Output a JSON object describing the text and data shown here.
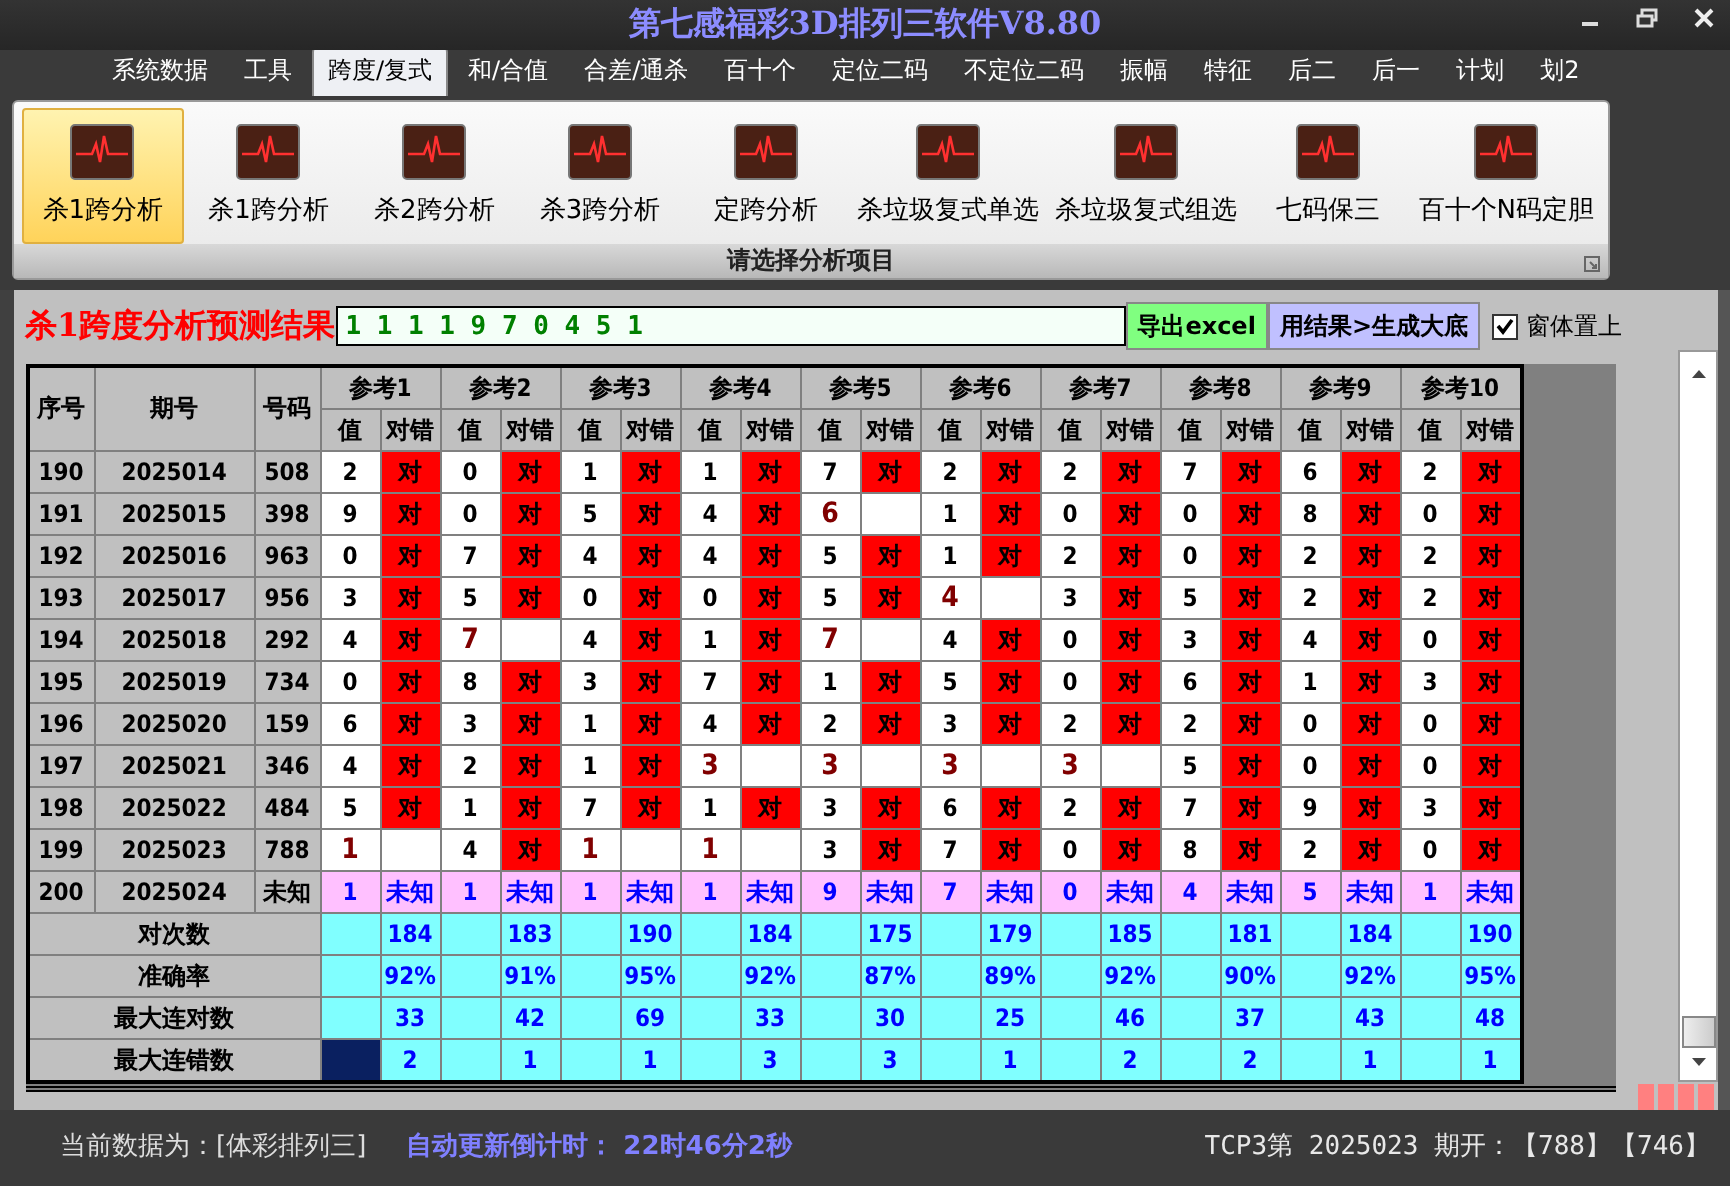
{
  "window": {
    "title": "第七感福彩3D排列三软件V8.80"
  },
  "menu": [
    {
      "label": "系统数据",
      "selected": false
    },
    {
      "label": "工具",
      "selected": false
    },
    {
      "label": "跨度/复式",
      "selected": true
    },
    {
      "label": "和/合值",
      "selected": false
    },
    {
      "label": "合差/通杀",
      "selected": false
    },
    {
      "label": "百十个",
      "selected": false
    },
    {
      "label": "定位二码",
      "selected": false
    },
    {
      "label": "不定位二码",
      "selected": false
    },
    {
      "label": "振幅",
      "selected": false
    },
    {
      "label": "特征",
      "selected": false
    },
    {
      "label": "后二",
      "selected": false
    },
    {
      "label": "后一",
      "selected": false
    },
    {
      "label": "计划",
      "selected": false
    },
    {
      "label": "划2",
      "selected": false
    }
  ],
  "ribbon": {
    "caption": "请选择分析项目",
    "items": [
      {
        "label": "杀1跨分析",
        "selected": true
      },
      {
        "label": "杀1跨分析",
        "selected": false
      },
      {
        "label": "杀2跨分析",
        "selected": false
      },
      {
        "label": "杀3跨分析",
        "selected": false
      },
      {
        "label": "定跨分析",
        "selected": false
      },
      {
        "label": "杀垃圾复式单选",
        "selected": false
      },
      {
        "label": "杀垃圾复式组选",
        "selected": false
      },
      {
        "label": "七码保三",
        "selected": false
      },
      {
        "label": "百十个N码定胆",
        "selected": false
      }
    ]
  },
  "result": {
    "label": "杀1跨度分析预测结果",
    "value": "1 1 1 1 9 7 0 4 5 1",
    "export_button": "导出excel",
    "generate_button": "用结果>生成大底",
    "pin_checkbox": {
      "label": "窗体置上",
      "checked": true
    }
  },
  "table": {
    "columns": [
      "序号",
      "期号",
      "号码"
    ],
    "groups": [
      {
        "label": "参考1",
        "sub_columns": [
          "值",
          "对错"
        ]
      },
      {
        "label": "参考2",
        "sub_columns": [
          "值",
          "对错"
        ]
      },
      {
        "label": "参考3",
        "sub_columns": [
          "值",
          "对错"
        ]
      },
      {
        "label": "参考4",
        "sub_columns": [
          "值",
          "对错"
        ]
      },
      {
        "label": "参考5",
        "sub_columns": [
          "值",
          "对错"
        ]
      },
      {
        "label": "参考6",
        "sub_columns": [
          "值",
          "对错"
        ]
      },
      {
        "label": "参考7",
        "sub_columns": [
          "值",
          "对错"
        ]
      },
      {
        "label": "参考8",
        "sub_columns": [
          "值",
          "对错"
        ]
      },
      {
        "label": "参考9",
        "sub_columns": [
          "值",
          "对错"
        ]
      },
      {
        "label": "参考10",
        "sub_columns": [
          "值",
          "对错"
        ]
      }
    ],
    "rows": [
      {
        "kind": "history",
        "seq": "190",
        "issue": "2025014",
        "number": "508",
        "refs": [
          {
            "value": "2",
            "hit": true,
            "result": "对"
          },
          {
            "value": "0",
            "hit": true,
            "result": "对"
          },
          {
            "value": "1",
            "hit": true,
            "result": "对"
          },
          {
            "value": "1",
            "hit": true,
            "result": "对"
          },
          {
            "value": "7",
            "hit": true,
            "result": "对"
          },
          {
            "value": "2",
            "hit": true,
            "result": "对"
          },
          {
            "value": "2",
            "hit": true,
            "result": "对"
          },
          {
            "value": "7",
            "hit": true,
            "result": "对"
          },
          {
            "value": "6",
            "hit": true,
            "result": "对"
          },
          {
            "value": "2",
            "hit": true,
            "result": "对"
          }
        ]
      },
      {
        "kind": "history",
        "seq": "191",
        "issue": "2025015",
        "number": "398",
        "refs": [
          {
            "value": "9",
            "hit": true,
            "result": "对"
          },
          {
            "value": "0",
            "hit": true,
            "result": "对"
          },
          {
            "value": "5",
            "hit": true,
            "result": "对"
          },
          {
            "value": "4",
            "hit": true,
            "result": "对"
          },
          {
            "value": "6",
            "hit": false
          },
          {
            "value": "1",
            "hit": true,
            "result": "对"
          },
          {
            "value": "0",
            "hit": true,
            "result": "对"
          },
          {
            "value": "0",
            "hit": true,
            "result": "对"
          },
          {
            "value": "8",
            "hit": true,
            "result": "对"
          },
          {
            "value": "0",
            "hit": true,
            "result": "对"
          }
        ]
      },
      {
        "kind": "history",
        "seq": "192",
        "issue": "2025016",
        "number": "963",
        "refs": [
          {
            "value": "0",
            "hit": true,
            "result": "对"
          },
          {
            "value": "7",
            "hit": true,
            "result": "对"
          },
          {
            "value": "4",
            "hit": true,
            "result": "对"
          },
          {
            "value": "4",
            "hit": true,
            "result": "对"
          },
          {
            "value": "5",
            "hit": true,
            "result": "对"
          },
          {
            "value": "1",
            "hit": true,
            "result": "对"
          },
          {
            "value": "2",
            "hit": true,
            "result": "对"
          },
          {
            "value": "0",
            "hit": true,
            "result": "对"
          },
          {
            "value": "2",
            "hit": true,
            "result": "对"
          },
          {
            "value": "2",
            "hit": true,
            "result": "对"
          }
        ]
      },
      {
        "kind": "history",
        "seq": "193",
        "issue": "2025017",
        "number": "956",
        "refs": [
          {
            "value": "3",
            "hit": true,
            "result": "对"
          },
          {
            "value": "5",
            "hit": true,
            "result": "对"
          },
          {
            "value": "0",
            "hit": true,
            "result": "对"
          },
          {
            "value": "0",
            "hit": true,
            "result": "对"
          },
          {
            "value": "5",
            "hit": true,
            "result": "对"
          },
          {
            "value": "4",
            "hit": false
          },
          {
            "value": "3",
            "hit": true,
            "result": "对"
          },
          {
            "value": "5",
            "hit": true,
            "result": "对"
          },
          {
            "value": "2",
            "hit": true,
            "result": "对"
          },
          {
            "value": "2",
            "hit": true,
            "result": "对"
          }
        ]
      },
      {
        "kind": "history",
        "seq": "194",
        "issue": "2025018",
        "number": "292",
        "refs": [
          {
            "value": "4",
            "hit": true,
            "result": "对"
          },
          {
            "value": "7",
            "hit": false
          },
          {
            "value": "4",
            "hit": true,
            "result": "对"
          },
          {
            "value": "1",
            "hit": true,
            "result": "对"
          },
          {
            "value": "7",
            "hit": false
          },
          {
            "value": "4",
            "hit": true,
            "result": "对"
          },
          {
            "value": "0",
            "hit": true,
            "result": "对"
          },
          {
            "value": "3",
            "hit": true,
            "result": "对"
          },
          {
            "value": "4",
            "hit": true,
            "result": "对"
          },
          {
            "value": "0",
            "hit": true,
            "result": "对"
          }
        ]
      },
      {
        "kind": "history",
        "seq": "195",
        "issue": "2025019",
        "number": "734",
        "refs": [
          {
            "value": "0",
            "hit": true,
            "result": "对"
          },
          {
            "value": "8",
            "hit": true,
            "result": "对"
          },
          {
            "value": "3",
            "hit": true,
            "result": "对"
          },
          {
            "value": "7",
            "hit": true,
            "result": "对"
          },
          {
            "value": "1",
            "hit": true,
            "result": "对"
          },
          {
            "value": "5",
            "hit": true,
            "result": "对"
          },
          {
            "value": "0",
            "hit": true,
            "result": "对"
          },
          {
            "value": "6",
            "hit": true,
            "result": "对"
          },
          {
            "value": "1",
            "hit": true,
            "result": "对"
          },
          {
            "value": "3",
            "hit": true,
            "result": "对"
          }
        ]
      },
      {
        "kind": "history",
        "seq": "196",
        "issue": "2025020",
        "number": "159",
        "refs": [
          {
            "value": "6",
            "hit": true,
            "result": "对"
          },
          {
            "value": "3",
            "hit": true,
            "result": "对"
          },
          {
            "value": "1",
            "hit": true,
            "result": "对"
          },
          {
            "value": "4",
            "hit": true,
            "result": "对"
          },
          {
            "value": "2",
            "hit": true,
            "result": "对"
          },
          {
            "value": "3",
            "hit": true,
            "result": "对"
          },
          {
            "value": "2",
            "hit": true,
            "result": "对"
          },
          {
            "value": "2",
            "hit": true,
            "result": "对"
          },
          {
            "value": "0",
            "hit": true,
            "result": "对"
          },
          {
            "value": "0",
            "hit": true,
            "result": "对"
          }
        ]
      },
      {
        "kind": "history",
        "seq": "197",
        "issue": "2025021",
        "number": "346",
        "refs": [
          {
            "value": "4",
            "hit": true,
            "result": "对"
          },
          {
            "value": "2",
            "hit": true,
            "result": "对"
          },
          {
            "value": "1",
            "hit": true,
            "result": "对"
          },
          {
            "value": "3",
            "hit": false
          },
          {
            "value": "3",
            "hit": false
          },
          {
            "value": "3",
            "hit": false
          },
          {
            "value": "3",
            "hit": false
          },
          {
            "value": "5",
            "hit": true,
            "result": "对"
          },
          {
            "value": "0",
            "hit": true,
            "result": "对"
          },
          {
            "value": "0",
            "hit": true,
            "result": "对"
          }
        ]
      },
      {
        "kind": "history",
        "seq": "198",
        "issue": "2025022",
        "number": "484",
        "refs": [
          {
            "value": "5",
            "hit": true,
            "result": "对"
          },
          {
            "value": "1",
            "hit": true,
            "result": "对"
          },
          {
            "value": "7",
            "hit": true,
            "result": "对"
          },
          {
            "value": "1",
            "hit": true,
            "result": "对"
          },
          {
            "value": "3",
            "hit": true,
            "result": "对"
          },
          {
            "value": "6",
            "hit": true,
            "result": "对"
          },
          {
            "value": "2",
            "hit": true,
            "result": "对"
          },
          {
            "value": "7",
            "hit": true,
            "result": "对"
          },
          {
            "value": "9",
            "hit": true,
            "result": "对"
          },
          {
            "value": "3",
            "hit": true,
            "result": "对"
          }
        ]
      },
      {
        "kind": "history",
        "seq": "199",
        "issue": "2025023",
        "number": "788",
        "refs": [
          {
            "value": "1",
            "hit": false
          },
          {
            "value": "4",
            "hit": true,
            "result": "对"
          },
          {
            "value": "1",
            "hit": false
          },
          {
            "value": "1",
            "hit": false
          },
          {
            "value": "3",
            "hit": true,
            "result": "对"
          },
          {
            "value": "7",
            "hit": true,
            "result": "对"
          },
          {
            "value": "0",
            "hit": true,
            "result": "对"
          },
          {
            "value": "8",
            "hit": true,
            "result": "对"
          },
          {
            "value": "2",
            "hit": true,
            "result": "对"
          },
          {
            "value": "0",
            "hit": true,
            "result": "对"
          }
        ]
      },
      {
        "kind": "prediction",
        "seq": "200",
        "issue": "2025024",
        "number": "未知",
        "refs": [
          {
            "value": "1",
            "result": "未知"
          },
          {
            "value": "1",
            "result": "未知"
          },
          {
            "value": "1",
            "result": "未知"
          },
          {
            "value": "1",
            "result": "未知"
          },
          {
            "value": "9",
            "result": "未知"
          },
          {
            "value": "7",
            "result": "未知"
          },
          {
            "value": "0",
            "result": "未知"
          },
          {
            "value": "4",
            "result": "未知"
          },
          {
            "value": "5",
            "result": "未知"
          },
          {
            "value": "1",
            "result": "未知"
          }
        ]
      }
    ],
    "stats": [
      {
        "label": "对次数",
        "cells": [
          {
            "text": "184",
            "selected": false
          },
          {
            "text": "183",
            "selected": false
          },
          {
            "text": "190",
            "selected": false
          },
          {
            "text": "184",
            "selected": false
          },
          {
            "text": "175",
            "selected": false
          },
          {
            "text": "179",
            "selected": false
          },
          {
            "text": "185",
            "selected": false
          },
          {
            "text": "181",
            "selected": false
          },
          {
            "text": "184",
            "selected": false
          },
          {
            "text": "190",
            "selected": false
          }
        ]
      },
      {
        "label": "准确率",
        "cells": [
          {
            "text": "92%",
            "selected": false
          },
          {
            "text": "91%",
            "selected": false
          },
          {
            "text": "95%",
            "selected": false
          },
          {
            "text": "92%",
            "selected": false
          },
          {
            "text": "87%",
            "selected": false
          },
          {
            "text": "89%",
            "selected": false
          },
          {
            "text": "92%",
            "selected": false
          },
          {
            "text": "90%",
            "selected": false
          },
          {
            "text": "92%",
            "selected": false
          },
          {
            "text": "95%",
            "selected": false
          }
        ]
      },
      {
        "label": "最大连对数",
        "cells": [
          {
            "text": "33",
            "selected": false
          },
          {
            "text": "42",
            "selected": false
          },
          {
            "text": "69",
            "selected": false
          },
          {
            "text": "33",
            "selected": false
          },
          {
            "text": "30",
            "selected": false
          },
          {
            "text": "25",
            "selected": false
          },
          {
            "text": "46",
            "selected": false
          },
          {
            "text": "37",
            "selected": false
          },
          {
            "text": "43",
            "selected": false
          },
          {
            "text": "48",
            "selected": false
          }
        ]
      },
      {
        "label": "最大连错数",
        "cells": [
          {
            "text": "2",
            "selected": true
          },
          {
            "text": "1",
            "selected": false
          },
          {
            "text": "1",
            "selected": false
          },
          {
            "text": "3",
            "selected": false
          },
          {
            "text": "3",
            "selected": false
          },
          {
            "text": "1",
            "selected": false
          },
          {
            "text": "2",
            "selected": false
          },
          {
            "text": "2",
            "selected": false
          },
          {
            "text": "1",
            "selected": false
          },
          {
            "text": "1",
            "selected": false
          }
        ]
      }
    ]
  },
  "status_bar": {
    "data_source": "当前数据为：[体彩排列三]",
    "countdown": "自动更新倒计时： 22时46分2秒",
    "latest_draw": "TCP3第 2025023 期开：【788】【746】"
  }
}
